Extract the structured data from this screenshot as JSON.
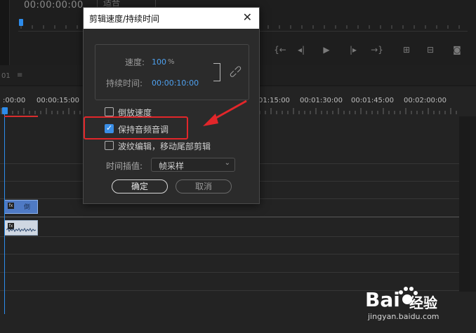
{
  "monitor": {
    "timecode": "00:00:00:00",
    "fit_value": "适合",
    "transport_buttons": [
      "mark-in-icon",
      "step-back-icon",
      "play-icon",
      "step-forward-icon",
      "go-to-out-icon",
      "insert-icon",
      "overwrite-icon",
      "export-frame-icon"
    ]
  },
  "timeline": {
    "sequence_tab": "01",
    "menu_icon": "≡",
    "timecodes": [
      ":00:00",
      "00:00:15:00",
      "01:15:00",
      "00:01:30:00",
      "00:01:45:00",
      "00:02:00:00"
    ],
    "video_clip_title": "倒",
    "fx_label": "fx"
  },
  "dialog": {
    "title": "剪辑速度/持续时间",
    "close_label": "✕",
    "speed_label": "速度:",
    "speed_value": "100",
    "speed_unit": "%",
    "duration_label": "持续时间:",
    "duration_value": "00:00:10:00",
    "options": [
      {
        "label": "倒放速度",
        "checked": false
      },
      {
        "label": "保持音频音调",
        "checked": true
      },
      {
        "label": "波纹编辑，移动尾部剪辑",
        "checked": false
      }
    ],
    "interp_label": "时间插值:",
    "interp_value": "帧采样",
    "ok_label": "确定",
    "cancel_label": "取消"
  },
  "colors": {
    "accent_blue": "#2d8ceb",
    "highlight_red": "#e2262a",
    "checkbox_blue": "#3a8ee6"
  },
  "watermark": {
    "brand": "Bai",
    "brand_suffix": "经验",
    "url": "jingyan.baidu.com"
  }
}
